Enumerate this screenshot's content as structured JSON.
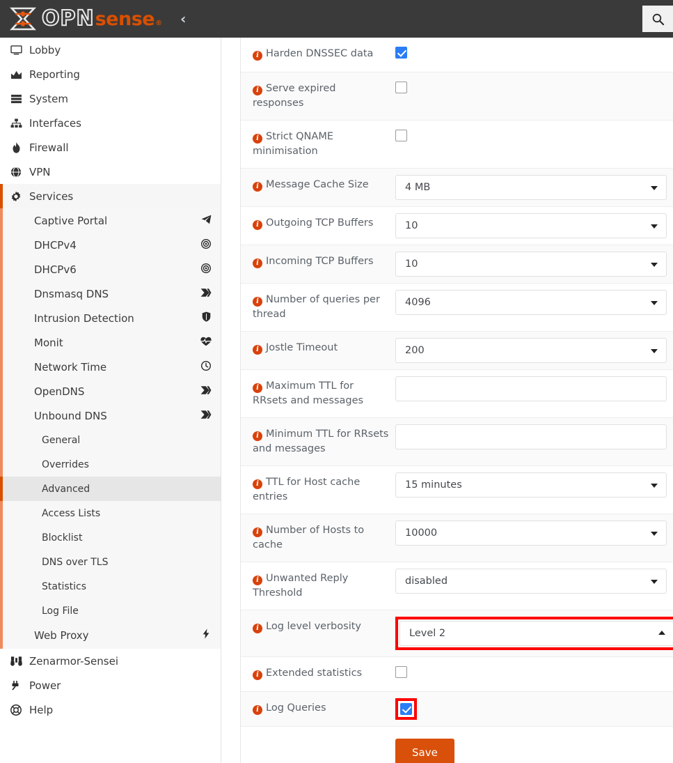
{
  "brand": {
    "name_part1": "OPN",
    "name_part2": "sense",
    "registered": "®",
    "collapse_label": "‹"
  },
  "topbar": {
    "search_icon": "search-icon"
  },
  "sidebar": {
    "top_items": [
      {
        "label": "Lobby",
        "icon": "monitor-icon"
      },
      {
        "label": "Reporting",
        "icon": "chart-area-icon"
      },
      {
        "label": "System",
        "icon": "server-icon"
      },
      {
        "label": "Interfaces",
        "icon": "sitemap-icon"
      },
      {
        "label": "Firewall",
        "icon": "fire-icon"
      },
      {
        "label": "VPN",
        "icon": "globe-icon"
      }
    ],
    "services": {
      "label": "Services",
      "icon": "gear-icon"
    },
    "service_items": [
      {
        "label": "Captive Portal",
        "icon": "paper-plane-icon"
      },
      {
        "label": "DHCPv4",
        "icon": "bullseye-icon"
      },
      {
        "label": "DHCPv6",
        "icon": "bullseye-icon"
      },
      {
        "label": "Dnsmasq DNS",
        "icon": "tag-icon"
      },
      {
        "label": "Intrusion Detection",
        "icon": "shield-icon"
      },
      {
        "label": "Monit",
        "icon": "heartbeat-icon"
      },
      {
        "label": "Network Time",
        "icon": "clock-icon"
      },
      {
        "label": "OpenDNS",
        "icon": "tag-icon"
      },
      {
        "label": "Unbound DNS",
        "icon": "tag-icon"
      }
    ],
    "unbound_children": [
      {
        "label": "General",
        "selected": false
      },
      {
        "label": "Overrides",
        "selected": false
      },
      {
        "label": "Advanced",
        "selected": true
      },
      {
        "label": "Access Lists",
        "selected": false
      },
      {
        "label": "Blocklist",
        "selected": false
      },
      {
        "label": "DNS over TLS",
        "selected": false
      },
      {
        "label": "Statistics",
        "selected": false
      },
      {
        "label": "Log File",
        "selected": false
      }
    ],
    "web_proxy": {
      "label": "Web Proxy",
      "icon": "bolt-icon"
    },
    "bottom_items": [
      {
        "label": "Zenarmor-Sensei",
        "icon": "binoculars-icon"
      },
      {
        "label": "Power",
        "icon": "plug-icon"
      },
      {
        "label": "Help",
        "icon": "life-ring-icon"
      }
    ]
  },
  "form": {
    "rows": [
      {
        "label": "Harden DNSSEC data",
        "type": "checkbox",
        "checked": true,
        "highlight": false
      },
      {
        "label": "Serve expired responses",
        "type": "checkbox",
        "checked": false,
        "highlight": false
      },
      {
        "label": "Strict QNAME minimisation",
        "type": "checkbox",
        "checked": false,
        "highlight": false
      },
      {
        "label": "Message Cache Size",
        "type": "select",
        "value": "4 MB",
        "open": false,
        "highlight": false
      },
      {
        "label": "Outgoing TCP Buffers",
        "type": "select",
        "value": "10",
        "open": false,
        "highlight": false
      },
      {
        "label": "Incoming TCP Buffers",
        "type": "select",
        "value": "10",
        "open": false,
        "highlight": false
      },
      {
        "label": "Number of queries per thread",
        "type": "select",
        "value": "4096",
        "open": false,
        "highlight": false
      },
      {
        "label": "Jostle Timeout",
        "type": "select",
        "value": "200",
        "open": false,
        "highlight": false
      },
      {
        "label": "Maximum TTL for RRsets and messages",
        "type": "text",
        "value": "",
        "placeholder": "",
        "highlight": false
      },
      {
        "label": "Minimum TTL for RRsets and messages",
        "type": "text",
        "value": "",
        "placeholder": "",
        "highlight": false
      },
      {
        "label": "TTL for Host cache entries",
        "type": "select",
        "value": "15 minutes",
        "open": false,
        "highlight": false
      },
      {
        "label": "Number of Hosts to cache",
        "type": "select",
        "value": "10000",
        "open": false,
        "highlight": false
      },
      {
        "label": "Unwanted Reply Threshold",
        "type": "select",
        "value": "disabled",
        "open": false,
        "highlight": false
      },
      {
        "label": "Log level verbosity",
        "type": "select",
        "value": "Level 2",
        "open": true,
        "highlight": true
      },
      {
        "label": "Extended statistics",
        "type": "checkbox",
        "checked": false,
        "highlight": false
      },
      {
        "label": "Log Queries",
        "type": "checkbox",
        "checked": true,
        "highlight": true
      }
    ],
    "save_label": "Save"
  },
  "colors": {
    "brand_orange": "#d94f00",
    "topbar_bg": "#3a3a3a",
    "info_icon": "#d9420b",
    "checkbox_checked": "#2b7df5",
    "highlight_box": "#ff0000",
    "save_button": "#d9500b",
    "sub_rail": "#f08a5d"
  }
}
